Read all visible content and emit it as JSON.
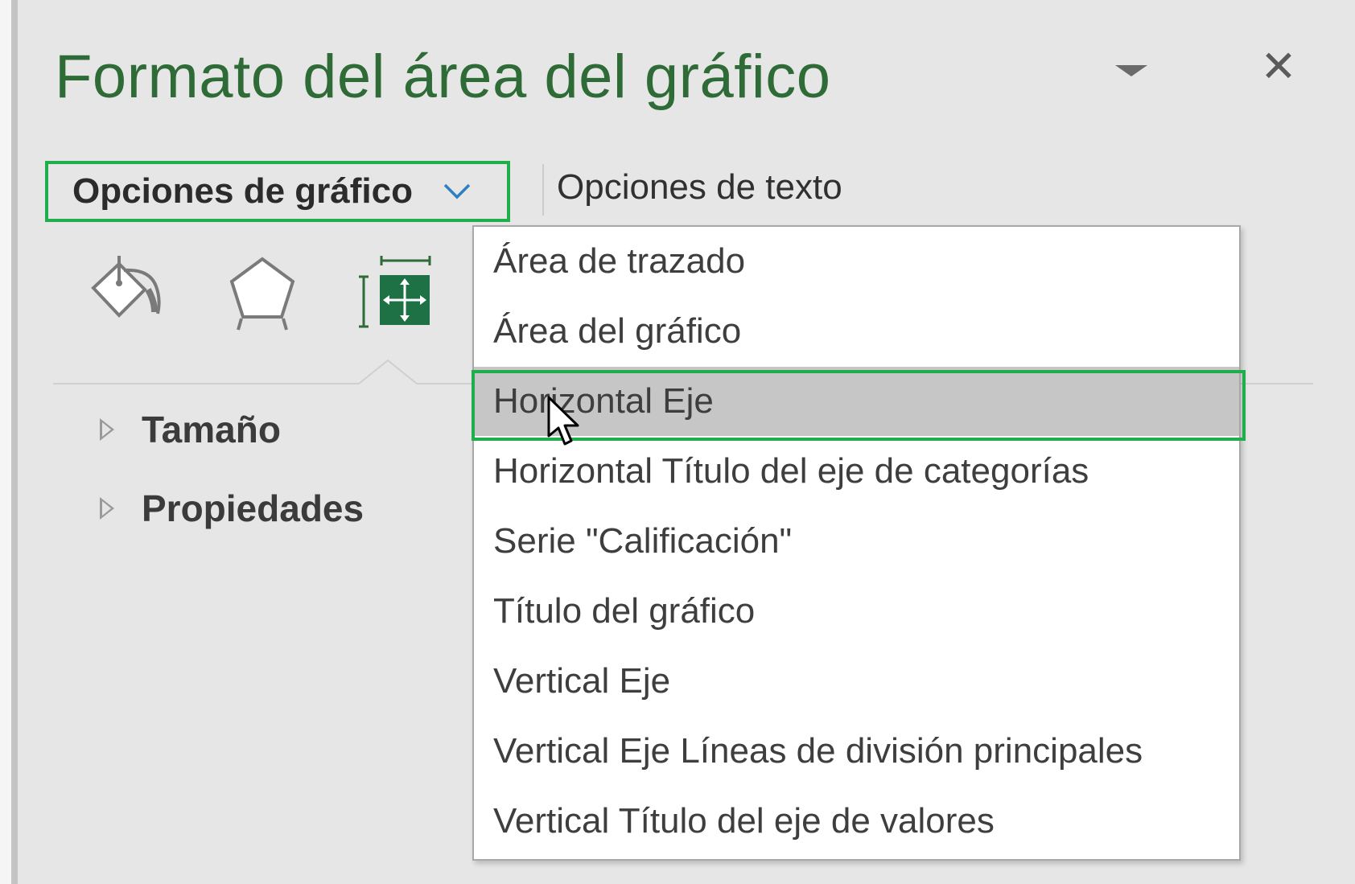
{
  "pane": {
    "title": "Formato del área del gráfico",
    "menu_icon": "dropdown-triangle-icon",
    "close_label": "✕"
  },
  "tabs": {
    "chart_options": "Opciones de gráfico",
    "text_options": "Opciones de texto"
  },
  "icons": {
    "fill": "fill-line-icon",
    "effects": "effects-pentagon-icon",
    "size": "size-properties-icon"
  },
  "sections": [
    {
      "label": "Tamaño"
    },
    {
      "label": "Propiedades"
    }
  ],
  "dropdown": {
    "items": [
      {
        "label": "Área de trazado"
      },
      {
        "label": "Área del gráfico"
      },
      {
        "label": "Horizontal Eje"
      },
      {
        "label": "Horizontal Título del eje de categorías"
      },
      {
        "label": "Serie \"Calificación\""
      },
      {
        "label": "Título del gráfico"
      },
      {
        "label": "Vertical Eje"
      },
      {
        "label": "Vertical Eje Líneas de división principales"
      },
      {
        "label": "Vertical Título del eje de valores"
      }
    ],
    "selected_label": "Horizontal Eje"
  },
  "colors": {
    "title_green": "#2e6b36",
    "highlight_green": "#1fae4a",
    "icon_green": "#1e7145",
    "selected_bg": "#c6c6c6",
    "pane_bg": "#e6e6e6"
  }
}
